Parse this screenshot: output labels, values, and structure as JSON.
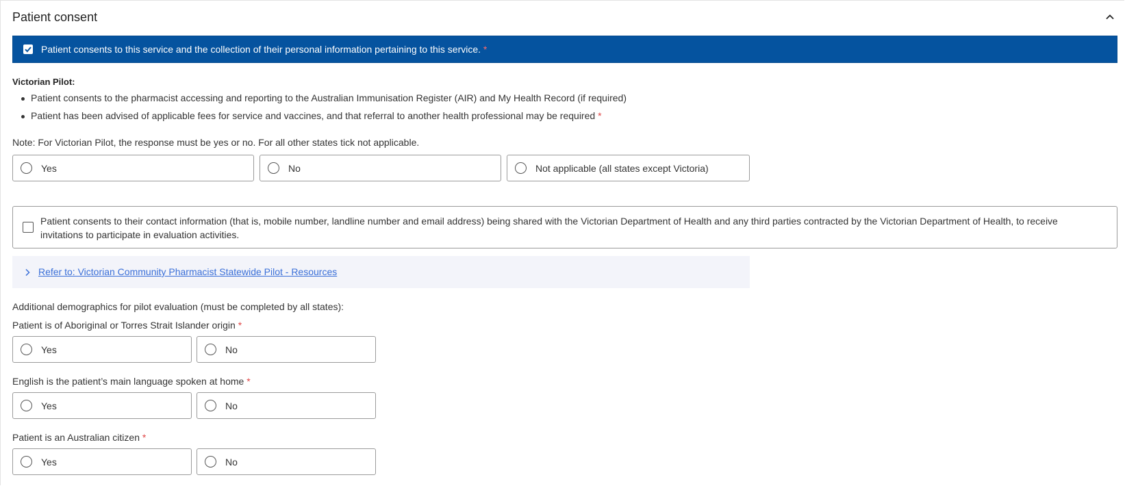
{
  "header": {
    "title": "Patient consent"
  },
  "consent": {
    "text": "Patient consents to this service and the collection of their personal information pertaining to this service.",
    "required_mark": "*",
    "checked": true
  },
  "pilot": {
    "title": "Victorian Pilot:",
    "bullets": [
      "Patient consents to the pharmacist accessing and reporting to the Australian Immunisation Register (AIR) and My Health Record (if required)",
      "Patient has been advised of applicable fees for service and vaccines, and that referral to another health professional may be required"
    ],
    "bullet2_required": "*",
    "note": "Note: For Victorian Pilot, the response must be yes or no. For all other states tick not applicable.",
    "options": [
      "Yes",
      "No",
      "Not applicable (all states except Victoria)"
    ]
  },
  "contact": {
    "text": "Patient consents to their contact information (that is, mobile number, landline number and email address) being shared with the Victorian Department of Health and any third parties contracted by the Victorian Department of Health, to receive invitations to participate in evaluation activities.",
    "checked": false
  },
  "resources": {
    "link_text": "Refer to: Victorian Community Pharmacist Statewide Pilot - Resources"
  },
  "demographics": {
    "intro": "Additional demographics for pilot evaluation (must be completed by all states):",
    "questions": [
      {
        "label": "Patient is of Aboriginal or Torres Strait Islander origin",
        "required": "*",
        "options": [
          "Yes",
          "No"
        ]
      },
      {
        "label": "English is the patient’s main language spoken at home",
        "required": "*",
        "options": [
          "Yes",
          "No"
        ]
      },
      {
        "label": "Patient is an Australian citizen",
        "required": "*",
        "options": [
          "Yes",
          "No"
        ]
      }
    ]
  },
  "colors": {
    "consent_bar": "#05539f",
    "required": "#e04545",
    "link": "#3a6fd8",
    "resources_bg": "#f3f4fa"
  }
}
